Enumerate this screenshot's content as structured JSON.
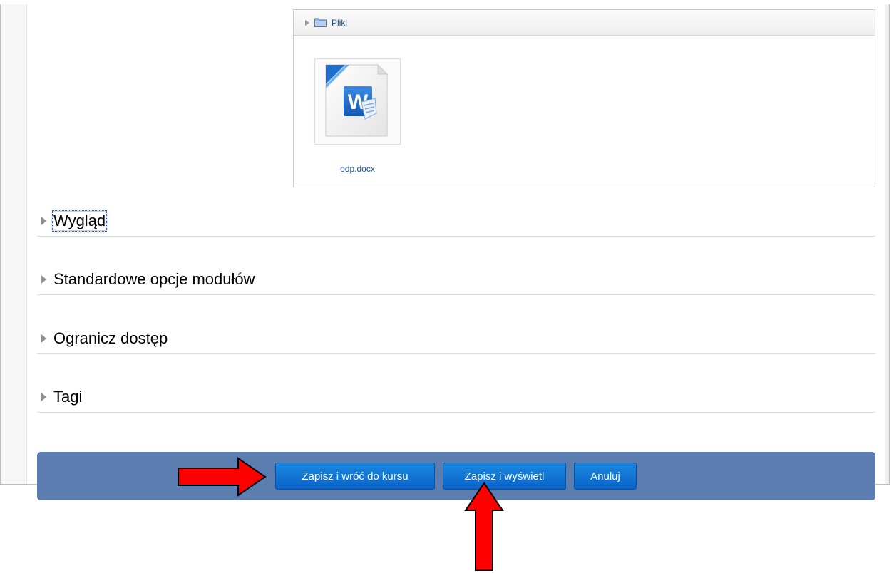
{
  "file_manager": {
    "breadcrumb_label": "Pliki",
    "files": [
      {
        "name": "odp.docx",
        "icon": "word-document-icon"
      }
    ]
  },
  "sections": [
    {
      "title": "Wygląd"
    },
    {
      "title": "Standardowe opcje modułów"
    },
    {
      "title": "Ogranicz dostęp"
    },
    {
      "title": "Tagi"
    }
  ],
  "buttons": {
    "save_return": "Zapisz i wróć do kursu",
    "save_display": "Zapisz i wyświetl",
    "cancel": "Anuluj"
  },
  "colors": {
    "button_bar": "#5b7db0",
    "button": "#0a63c9",
    "annotation_arrow": "#ff0000"
  }
}
